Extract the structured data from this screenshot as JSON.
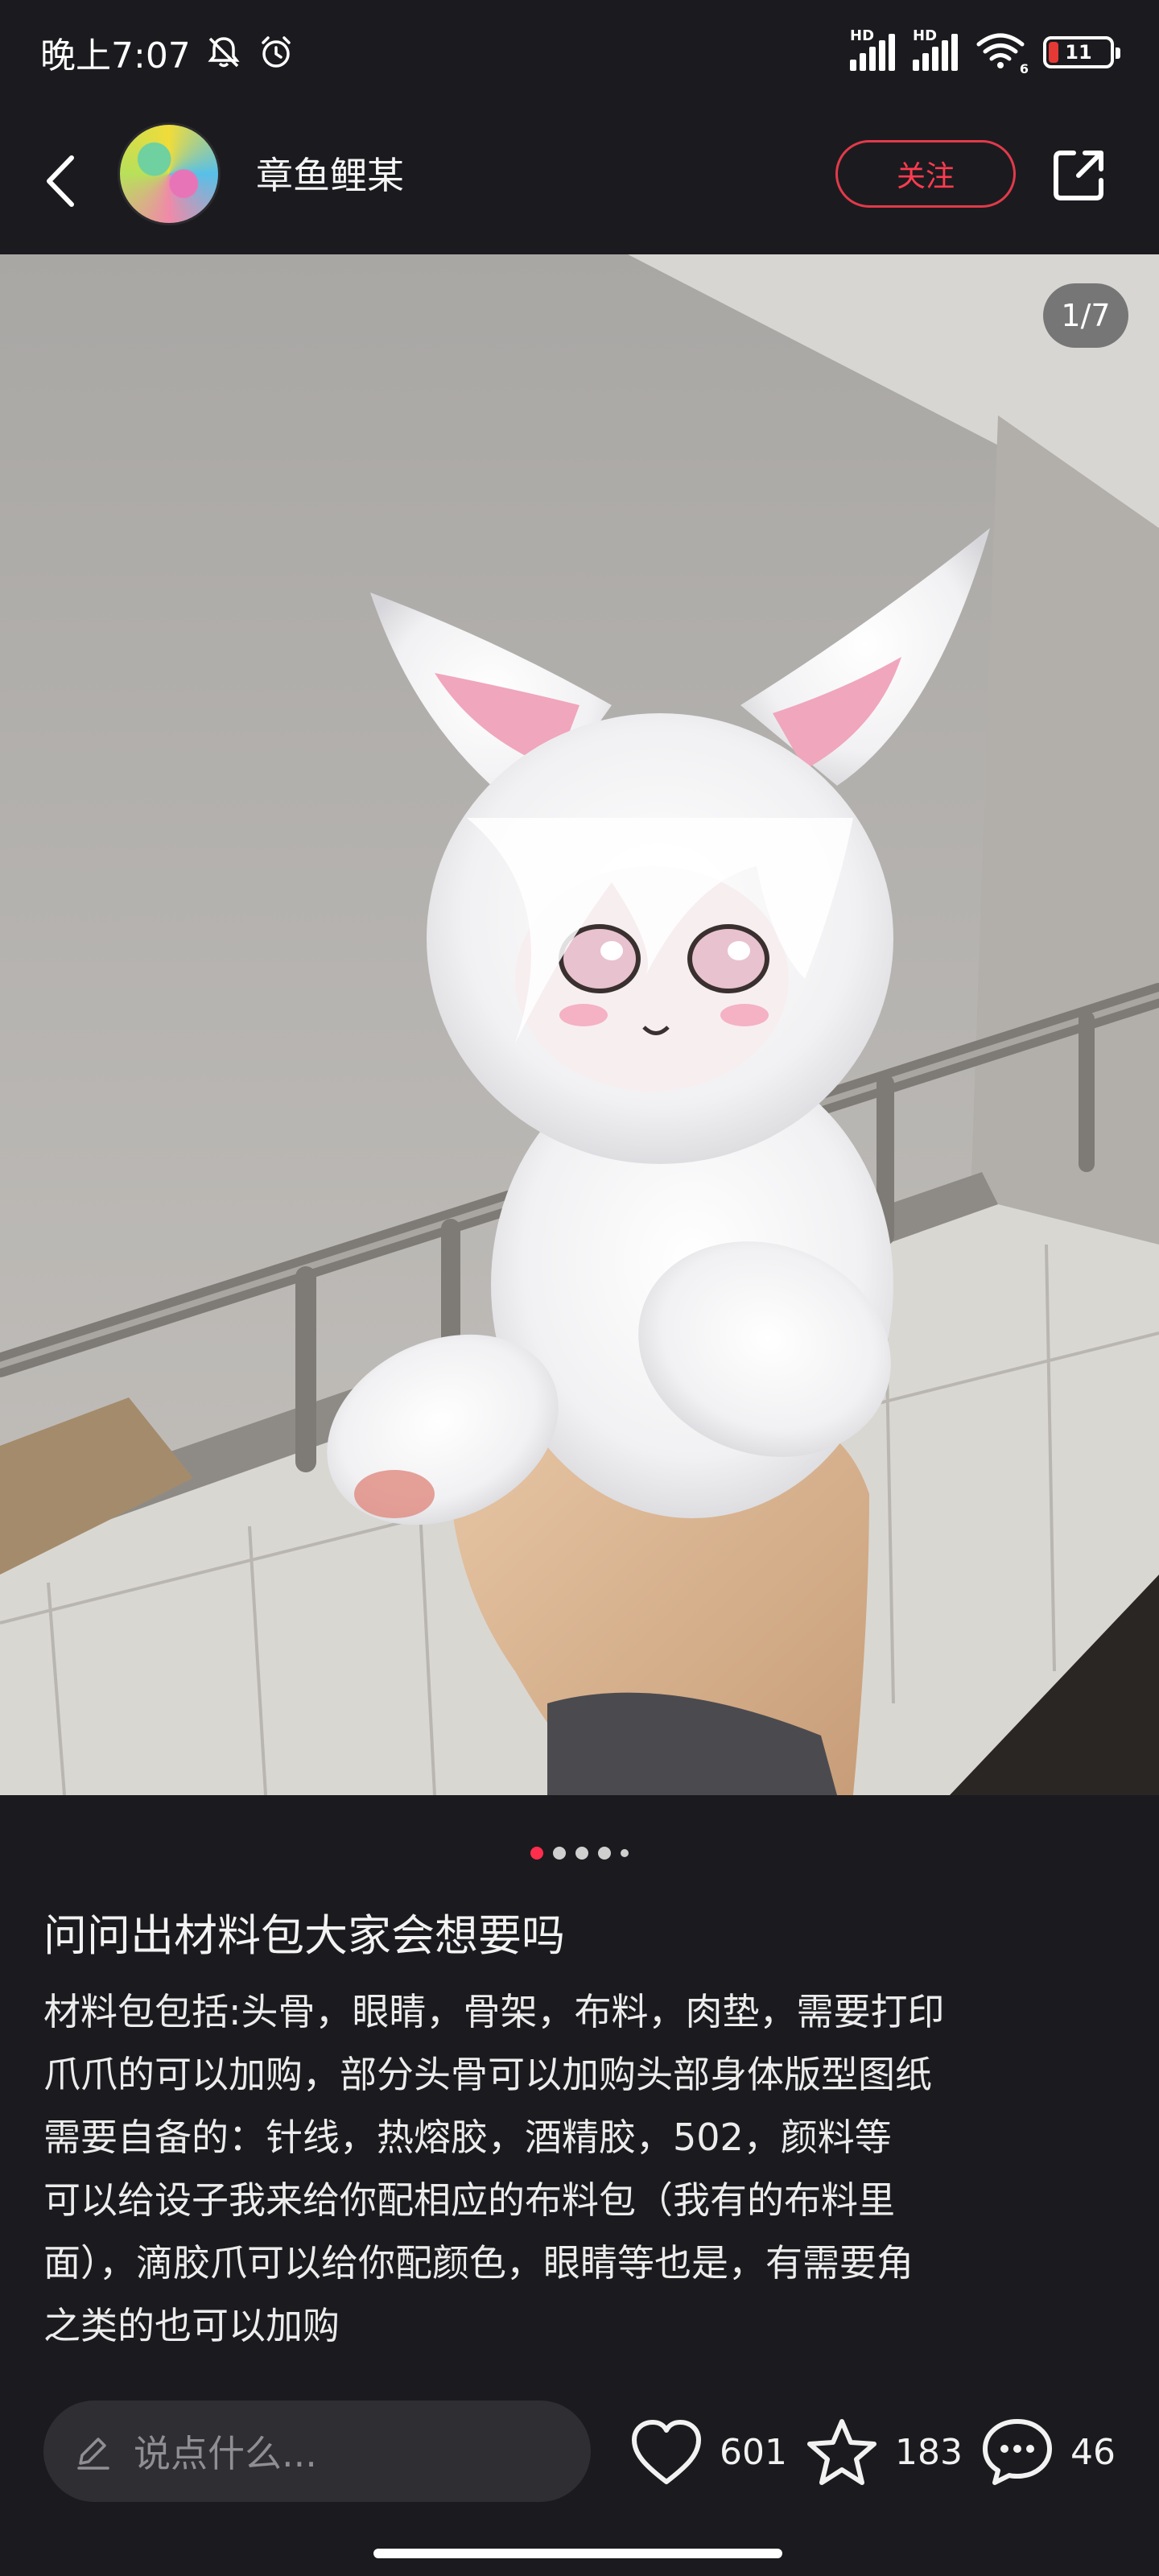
{
  "status_bar": {
    "time": "晚上7:07",
    "network_1": "HD",
    "network_2": "HD",
    "wifi_badge": "6",
    "battery": "11",
    "icons": [
      "mute-bell-icon",
      "alarm-icon",
      "signal-icon",
      "wifi-icon",
      "battery-icon"
    ]
  },
  "header": {
    "username": "章鱼鲤某",
    "follow_label": "关注",
    "accent": "#ff2e4d"
  },
  "photo": {
    "counter": "1/7"
  },
  "carousel": {
    "active_index": 0,
    "dot_count": 5
  },
  "post": {
    "title": "问问出材料包大家会想要吗",
    "lines": [
      "材料包包括:头骨，眼睛，骨架，布料，肉垫，需要打印",
      "爪爪的可以加购，部分头骨可以加购头部身体版型图纸",
      "需要自备的：针线，热熔胶，酒精胶，502，颜料等",
      "可以给设子我来给你配相应的布料包（我有的布料里",
      "面），滴胶爪可以给你配颜色，眼睛等也是，有需要角",
      "之类的也可以加购"
    ]
  },
  "bottom_bar": {
    "comment_placeholder": "说点什么...",
    "likes": "601",
    "favorites": "183",
    "comments": "46"
  }
}
